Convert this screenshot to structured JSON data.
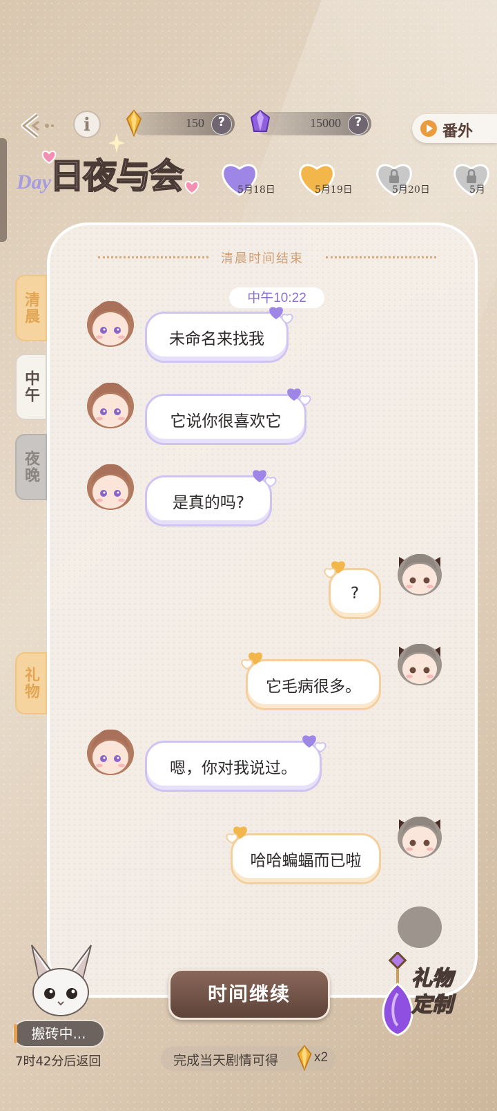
{
  "header": {
    "crystal_count": "150",
    "gem_count": "15000",
    "help_label": "?",
    "extra_label": "番外",
    "info_label": "i"
  },
  "logo": {
    "day_label": "Day",
    "title": "日夜与会"
  },
  "dates": [
    {
      "label": "5月18日",
      "state": "completed",
      "color": "#9d86e6"
    },
    {
      "label": "5月19日",
      "state": "current",
      "color": "#f2b64b"
    },
    {
      "label": "5月20日",
      "state": "locked",
      "color": "#c8c8c8"
    },
    {
      "label": "5月",
      "state": "locked",
      "color": "#c8c8c8"
    }
  ],
  "tabs": {
    "morning": "清晨",
    "noon": "中午",
    "night": "夜晚",
    "gift": "礼物"
  },
  "chat": {
    "section_divider": "清晨时间结束",
    "timestamp": "中午10:22",
    "messages": [
      {
        "side": "left",
        "text": "未命名来找我"
      },
      {
        "side": "left",
        "text": "它说你很喜欢它"
      },
      {
        "side": "left",
        "text": "是真的吗?"
      },
      {
        "side": "right",
        "text": "?"
      },
      {
        "side": "right",
        "text": "它毛病很多。"
      },
      {
        "side": "left",
        "text": "嗯，你对我说过。"
      },
      {
        "side": "right",
        "text": "哈哈蝙蝠而已啦"
      }
    ]
  },
  "footer": {
    "continue_label": "时间继续",
    "reward_text": "完成当天剧情可得",
    "reward_multiplier": "x2",
    "pet_status": "搬砖中...",
    "pet_return": "7时42分后返回",
    "gift_custom_label_1": "礼物",
    "gift_custom_label_2": "定制"
  },
  "colors": {
    "left_bubble_border": "#cfc3f2",
    "right_bubble_border": "#f4cf9c",
    "accent_purple": "#8c6fd4",
    "accent_orange": "#e99b3d"
  }
}
